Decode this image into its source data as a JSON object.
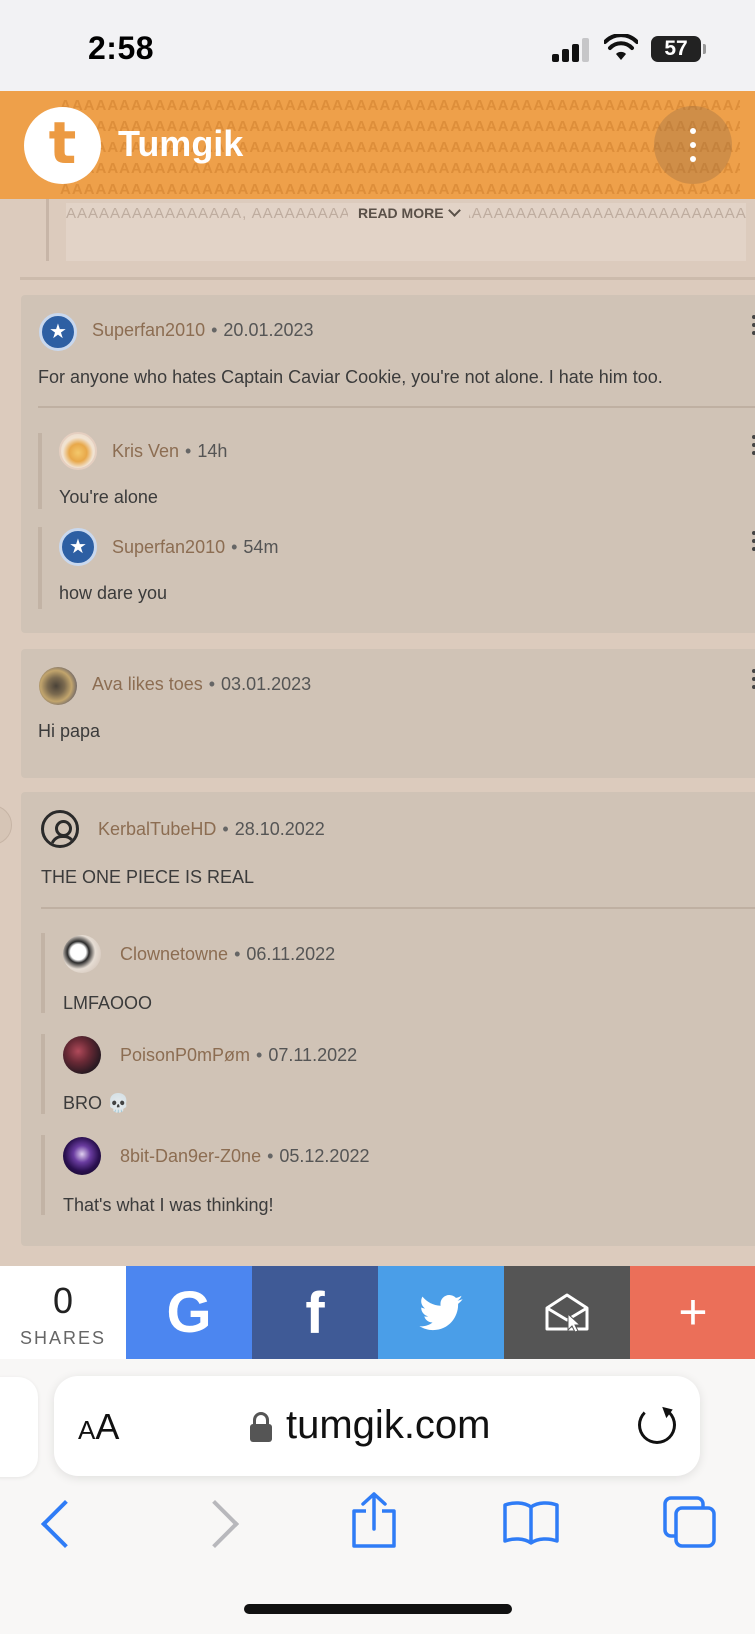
{
  "status_bar": {
    "time": "2:58",
    "battery": "57"
  },
  "app": {
    "logo_letter": "t",
    "name": "Tumgik",
    "pattern_text": "AAAAAAAAAAAAAAAAAAAAAAAAAAAAAAAAAAAAAAAAAAAAAAAAAAAAAAAAAAAA"
  },
  "read_more": {
    "label": "READ MORE",
    "faded_text": "AAAAAAAAAAAAAAAA, AAAAAAAAAAAAAAAAAAAAAAAAAAAAAAAAAAAAAAAAAAAAAAAAAAAAAAAAAAAAAAAAAAA"
  },
  "comments": [
    {
      "author": "Superfan2010",
      "date": "20.01.2023",
      "avatar_icon": "star-badge-icon",
      "text": "For anyone who hates Captain Caviar Cookie, you're not alone. I hate him too.",
      "replies": [
        {
          "author": "Kris Ven",
          "date": "14h",
          "text": "You're alone",
          "avatar_icon": "user-avatar"
        },
        {
          "author": "Superfan2010",
          "date": "54m",
          "text": "how dare you",
          "avatar_icon": "star-badge-icon"
        }
      ]
    },
    {
      "author": "Ava likes toes",
      "date": "03.01.2023",
      "avatar_icon": "user-avatar",
      "text": "Hi papa",
      "replies": []
    },
    {
      "author": "KerbalTubeHD",
      "date": "28.10.2022",
      "avatar_icon": "default-user-icon",
      "text": "THE ONE PIECE IS REAL",
      "replies": [
        {
          "author": "Clownetowne",
          "date": "06.11.2022",
          "text": "LMFAOOO",
          "avatar_icon": "user-avatar"
        },
        {
          "author": "PoisonP0mPøm",
          "date": "07.11.2022",
          "text": "BRO 💀",
          "avatar_icon": "user-avatar"
        },
        {
          "author": "8bit-Dan9er-Z0ne",
          "date": "05.12.2022",
          "text": "That's what I was thinking!",
          "avatar_icon": "user-avatar"
        }
      ]
    }
  ],
  "share_bar": {
    "count": "0",
    "count_label": "SHARES",
    "buttons": [
      {
        "name": "google",
        "glyph": "G",
        "color": "#4c86f0"
      },
      {
        "name": "facebook",
        "glyph": "f",
        "color": "#3f5a96"
      },
      {
        "name": "twitter",
        "glyph": "twitter-bird-icon",
        "color": "#4a9ee8"
      },
      {
        "name": "email",
        "glyph": "envelope-icon",
        "color": "#555555"
      },
      {
        "name": "more",
        "glyph": "+",
        "color": "#eb6f59"
      }
    ]
  },
  "browser": {
    "aa_label": "AA",
    "url": "tumgik.com",
    "accent": "#2f7cf6"
  }
}
